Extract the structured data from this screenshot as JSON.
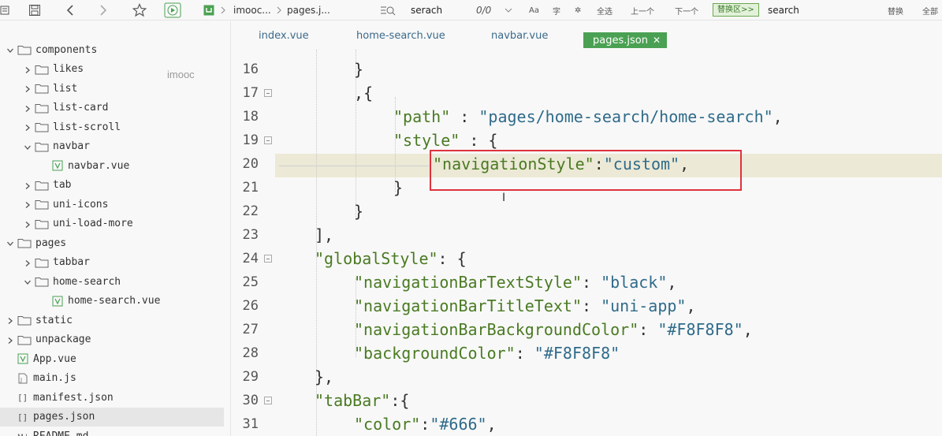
{
  "toolbar": {
    "breadcrumb_project": "imooc...",
    "breadcrumb_file": "pages.j...",
    "find_value": "serach",
    "match_count": "0/0",
    "opt_case": "Aa",
    "opt_word": "字",
    "opt_regex": "✲",
    "select_all": "全选",
    "prev": "上一个",
    "next": "下一个",
    "replace_area": "替换区>>",
    "replace_value": "search",
    "replace_btn": "替换",
    "replace_all": "全部"
  },
  "sidebar": {
    "watermark": "imooc",
    "items": [
      {
        "label": "components",
        "kind": "folder",
        "level": 0,
        "expanded": true
      },
      {
        "label": "likes",
        "kind": "folder",
        "level": 1,
        "expanded": false
      },
      {
        "label": "list",
        "kind": "folder",
        "level": 1,
        "expanded": false
      },
      {
        "label": "list-card",
        "kind": "folder",
        "level": 1,
        "expanded": false
      },
      {
        "label": "list-scroll",
        "kind": "folder",
        "level": 1,
        "expanded": false
      },
      {
        "label": "navbar",
        "kind": "folder",
        "level": 1,
        "expanded": true
      },
      {
        "label": "navbar.vue",
        "kind": "vue",
        "level": 2
      },
      {
        "label": "tab",
        "kind": "folder",
        "level": 1,
        "expanded": false
      },
      {
        "label": "uni-icons",
        "kind": "folder",
        "level": 1,
        "expanded": false
      },
      {
        "label": "uni-load-more",
        "kind": "folder",
        "level": 1,
        "expanded": false
      },
      {
        "label": "pages",
        "kind": "folder",
        "level": 0,
        "expanded": true
      },
      {
        "label": "tabbar",
        "kind": "folder",
        "level": 1,
        "expanded": false
      },
      {
        "label": "home-search",
        "kind": "folder",
        "level": 1,
        "expanded": true
      },
      {
        "label": "home-search.vue",
        "kind": "vue",
        "level": 2
      },
      {
        "label": "static",
        "kind": "folder",
        "level": 0,
        "expanded": false
      },
      {
        "label": "unpackage",
        "kind": "folder",
        "level": 0,
        "expanded": false
      },
      {
        "label": "App.vue",
        "kind": "vue",
        "level": 0
      },
      {
        "label": "main.js",
        "kind": "js",
        "level": 0
      },
      {
        "label": "manifest.json",
        "kind": "json",
        "level": 0
      },
      {
        "label": "pages.json",
        "kind": "json",
        "level": 0,
        "active": true
      },
      {
        "label": "README.md",
        "kind": "md",
        "level": 0
      }
    ]
  },
  "tabs": [
    {
      "label": "index.vue"
    },
    {
      "label": "home-search.vue"
    },
    {
      "label": "navbar.vue"
    },
    {
      "label": "pages.json",
      "active": true
    }
  ],
  "editor": {
    "lines": [
      {
        "num": "16",
        "fold": false
      },
      {
        "num": "17",
        "fold": true
      },
      {
        "num": "18",
        "fold": false
      },
      {
        "num": "19",
        "fold": true
      },
      {
        "num": "20",
        "fold": false
      },
      {
        "num": "21",
        "fold": false
      },
      {
        "num": "22",
        "fold": false
      },
      {
        "num": "23",
        "fold": false
      },
      {
        "num": "24",
        "fold": true
      },
      {
        "num": "25",
        "fold": false
      },
      {
        "num": "26",
        "fold": false
      },
      {
        "num": "27",
        "fold": false
      },
      {
        "num": "28",
        "fold": false
      },
      {
        "num": "29",
        "fold": false
      },
      {
        "num": "30",
        "fold": true
      },
      {
        "num": "31",
        "fold": false
      }
    ],
    "code": {
      "l16": "}",
      "l17": ",{",
      "l18_key": "\"path\"",
      "l18_sep": " : ",
      "l18_val": "\"pages/home-search/home-search\"",
      "l18_end": ",",
      "l19_key": "\"style\"",
      "l19_sep": " : {",
      "l20_key": "\"navigationStyle\"",
      "l20_sep": ":",
      "l20_val": "\"custom\"",
      "l20_end": ",",
      "l21": "}",
      "l22": "}",
      "l23": "],",
      "l24_key": "\"globalStyle\"",
      "l24_sep": ": {",
      "l25_key": "\"navigationBarTextStyle\"",
      "l25_sep": ": ",
      "l25_val": "\"black\"",
      "l25_end": ",",
      "l26_key": "\"navigationBarTitleText\"",
      "l26_sep": ": ",
      "l26_val": "\"uni-app\"",
      "l26_end": ",",
      "l27_key": "\"navigationBarBackgroundColor\"",
      "l27_sep": ": ",
      "l27_val": "\"#F8F8F8\"",
      "l27_end": ",",
      "l28_key": "\"backgroundColor\"",
      "l28_sep": ": ",
      "l28_val": "\"#F8F8F8\"",
      "l29": "},",
      "l30_key": "\"tabBar\"",
      "l30_sep": ":{",
      "l31_key": "\"color\"",
      "l31_sep": ":",
      "l31_val": "\"#666\"",
      "l31_end": ","
    }
  },
  "colors": {
    "active_tab": "#4aa153",
    "highlight_box": "#e0323d",
    "key_green": "#4a7a23",
    "string_blue": "#2f6b8a"
  }
}
